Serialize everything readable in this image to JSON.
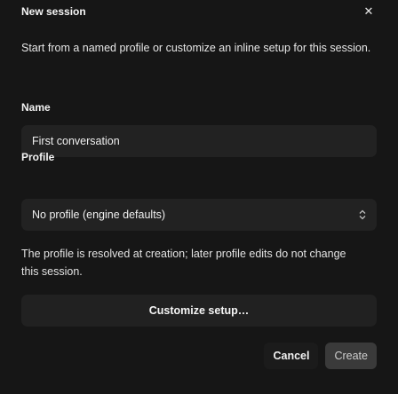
{
  "dialog": {
    "title": "New session",
    "close_icon": "close-icon",
    "description": "Start from a named profile or customize an inline setup for this session."
  },
  "name_section": {
    "label": "Name",
    "value": "First conversation"
  },
  "profile_section": {
    "label": "Profile",
    "selected": "No profile (engine defaults)",
    "chevron_icon": "chevron-up-down-icon",
    "note": "The profile is resolved at creation; later profile edits do not change this session."
  },
  "customize_label": "Customize setup…",
  "actions": {
    "cancel_label": "Cancel",
    "create_label": "Create"
  },
  "colors": {
    "background": "#161616",
    "field": "#222222",
    "create_button": "#3a3a3a"
  }
}
